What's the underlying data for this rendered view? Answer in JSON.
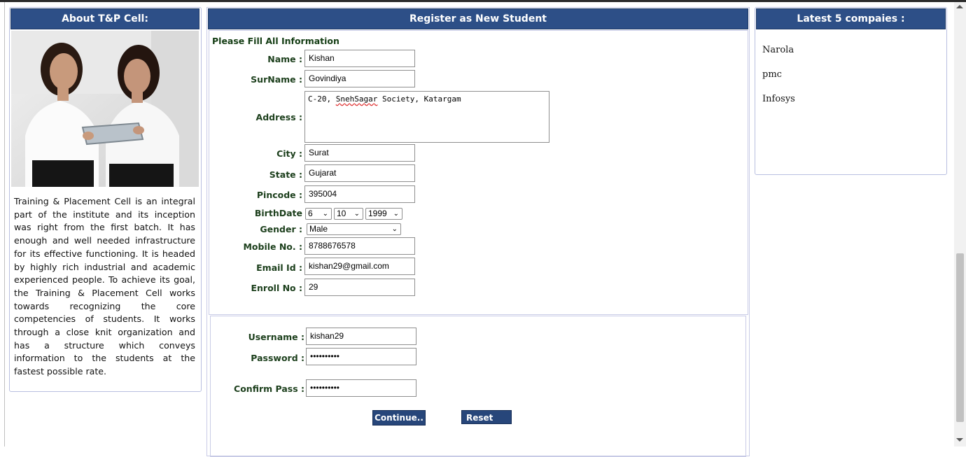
{
  "left_panel": {
    "title": "About T&P Cell:",
    "description": "Training & Placement Cell is an integral part of the institute and its inception was right from the first batch. It has enough and well needed infrastructure for its effective functioning. It is headed by highly rich industrial and academic experienced people. To achieve its goal, the Training & Placement Cell works towards recognizing the core competencies of students. It works through a close knit organization and has a structure which conveys information to the students at the fastest possible rate."
  },
  "register": {
    "title": "Register as New Student",
    "subtitle": "Please Fill All Information",
    "fields": {
      "name": {
        "label": "Name :",
        "value": "Kishan"
      },
      "surname": {
        "label": "SurName :",
        "value": "Govindiya"
      },
      "address": {
        "label": "Address :",
        "value_prefix": "C-20, ",
        "value_misspelled": "SnehSagar",
        "value_suffix": " Society, Katargam"
      },
      "city": {
        "label": "City :",
        "value": "Surat"
      },
      "state": {
        "label": "State :",
        "value": "Gujarat"
      },
      "pincode": {
        "label": "Pincode :",
        "value": "395004"
      },
      "birthdate": {
        "label": "BirthDate",
        "day": "6",
        "month": "10",
        "year": "1999"
      },
      "gender": {
        "label": "Gender :",
        "value": "Male"
      },
      "mobile": {
        "label": "Mobile No. :",
        "value": "8788676578"
      },
      "email": {
        "label": "Email Id :",
        "value": "kishan29@gmail.com"
      },
      "enroll": {
        "label": "Enroll No :",
        "value": "29"
      }
    },
    "credentials": {
      "username": {
        "label": "Username :",
        "value": "kishan29"
      },
      "password": {
        "label": "Password :",
        "value": "••••••••••"
      },
      "confirm": {
        "label": "Confirm Pass :",
        "value": "••••••••••"
      }
    },
    "buttons": {
      "continue": "Continue..",
      "reset": "Reset"
    }
  },
  "right_panel": {
    "title": "Latest 5 compaies :",
    "companies": [
      "Narola",
      "pmc",
      "Infosys"
    ]
  },
  "colors": {
    "header_bg": "#2d4f87",
    "label_text": "#1c3f1c"
  }
}
